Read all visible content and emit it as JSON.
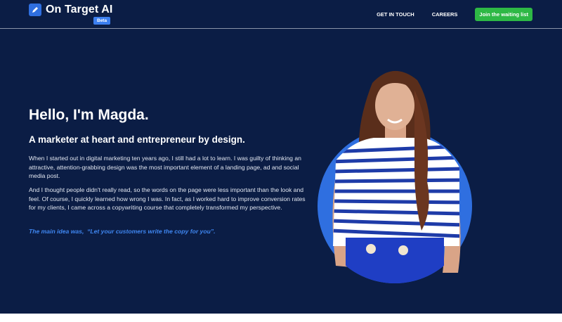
{
  "header": {
    "brand": "On Target AI",
    "badge": "Beta",
    "nav": {
      "get_in_touch": "GET IN TOUCH",
      "careers": "CAREERS",
      "cta": "Join the waiting list"
    }
  },
  "hero": {
    "title": "Hello, I'm Magda.",
    "subtitle": "A marketer at heart and entrepreneur by design.",
    "paragraph1": "When I started out in digital marketing ten years ago, I still had a lot to learn. I was guilty of thinking an attractive, attention-grabbing design was the most important element of a landing page, ad and social media post.",
    "paragraph2": "And I thought people didn't really read, so the words on the page were less important than the look and feel. Of course, I quickly learned how wrong I was. In fact, as I worked hard to improve conversion rates for my clients, I came across a copywriting course that completely transformed my perspective.",
    "quote_lead": "The main idea was,",
    "quote_text": "“Let your customers write the copy for you”."
  },
  "colors": {
    "background": "#0b1d45",
    "accent": "#2f6fe0",
    "cta": "#2eb845",
    "quote": "#3f86f0"
  },
  "icons": {
    "logo": "pencil-icon"
  }
}
